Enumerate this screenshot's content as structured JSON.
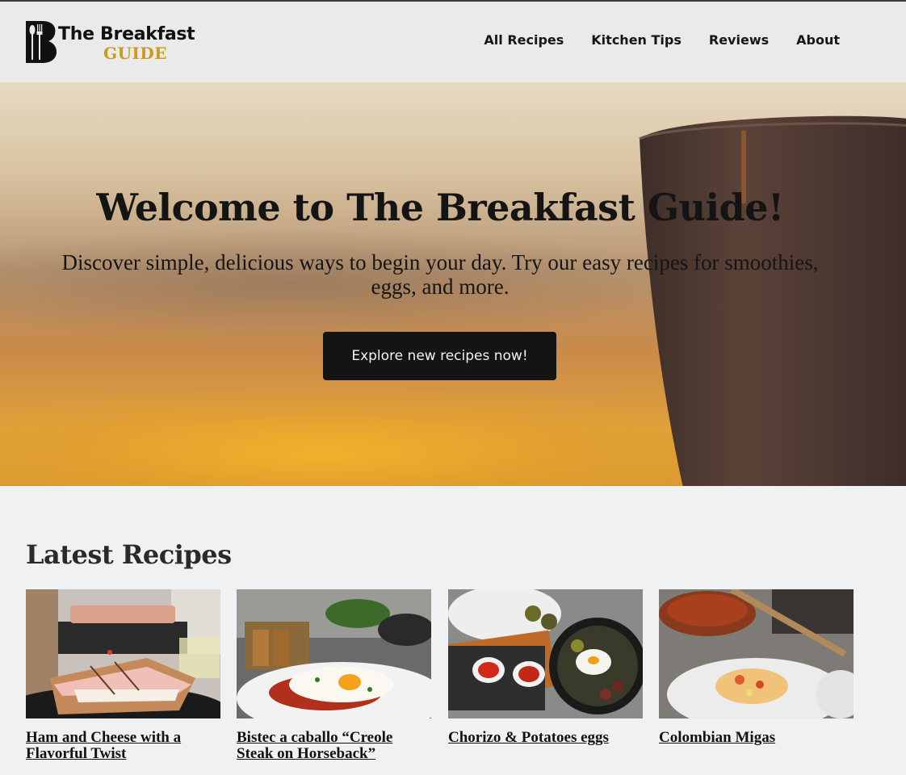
{
  "site": {
    "logo_title": "The Breakfast",
    "logo_subtitle": "GUIDE"
  },
  "nav": [
    {
      "label": "All Recipes"
    },
    {
      "label": "Kitchen Tips"
    },
    {
      "label": "Reviews"
    },
    {
      "label": "About"
    }
  ],
  "hero": {
    "title": "Welcome to The Breakfast Guide!",
    "text": "Discover simple, delicious ways to begin your day. Try our easy recipes for smoothies, eggs, and more.",
    "button_label": "Explore new recipes now!"
  },
  "latest": {
    "heading": "Latest Recipes",
    "recipes": [
      {
        "title": "Ham and Cheese with a Flavorful Twist",
        "image": "ham-and-cheese-sandwich-photo"
      },
      {
        "title": "Bistec a caballo “Creole Steak on Horseback”",
        "image": "steak-with-fried-egg-photo"
      },
      {
        "title": "Chorizo & Potatoes eggs",
        "image": "chorizo-potatoes-eggs-pan-photo"
      },
      {
        "title": "Colombian Migas",
        "image": "colombian-migas-plate-photo"
      }
    ]
  },
  "colors": {
    "accent_gold": "#c99a1c",
    "button_bg": "#141414",
    "header_bg": "#eaeaea",
    "page_bg": "#f0f1f3"
  }
}
